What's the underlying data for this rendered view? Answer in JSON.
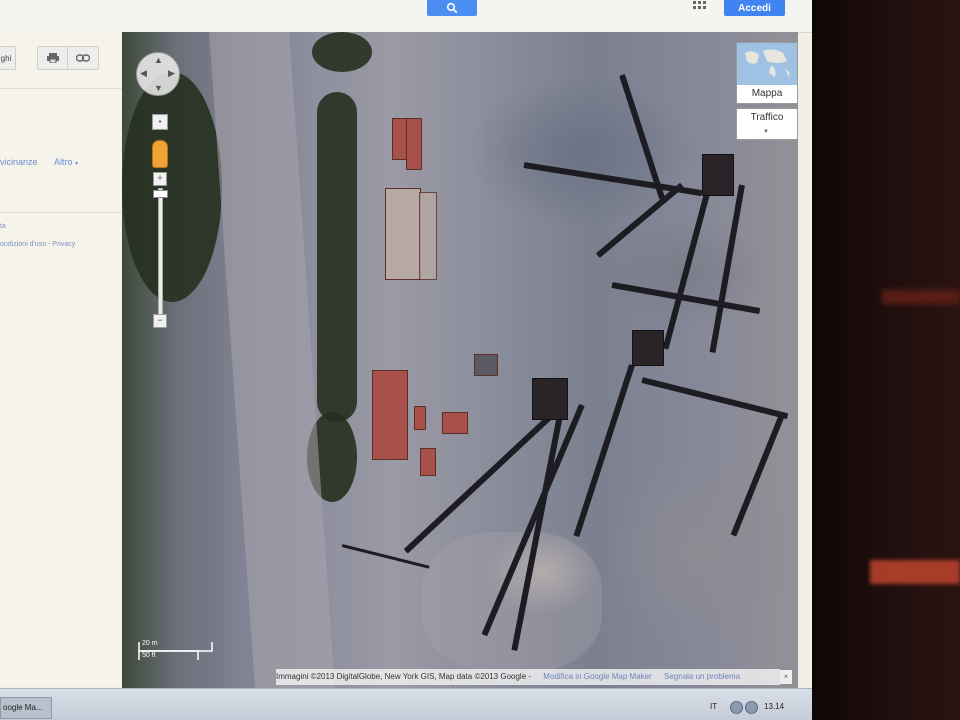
{
  "header": {
    "search_icon": "search-icon",
    "apps_icon": "apps-grid-icon",
    "signin_label": "Accedi"
  },
  "left_panel": {
    "button_partial_label": "ghi",
    "print_icon": "print-icon",
    "link_icon": "link-icon",
    "nearby_label": "vicinanze",
    "more_label": "Altro",
    "small_a": "ta",
    "legal_text": "ondizioni d'uso - Privacy"
  },
  "map": {
    "map_type_label": "Mappa",
    "traffic_label": "Traffico",
    "zoom_plus": "+",
    "zoom_minus": "−",
    "scale_top": "20 m",
    "scale_bottom": "50 ft",
    "attribution": "Immagini ©2013 DigitalGlobe, New York GIS, Map data ©2013 Google -",
    "mapmaker_link": "Modifica in Google Map Maker",
    "report_link": "Segnala un problema",
    "close_icon": "close-icon"
  },
  "taskbar": {
    "task_label": "oogle Ma...",
    "language": "IT",
    "time": "13.14"
  },
  "colors": {
    "accent_blue": "#3f84f0",
    "monitor_bezel": "#1c0d0c"
  }
}
